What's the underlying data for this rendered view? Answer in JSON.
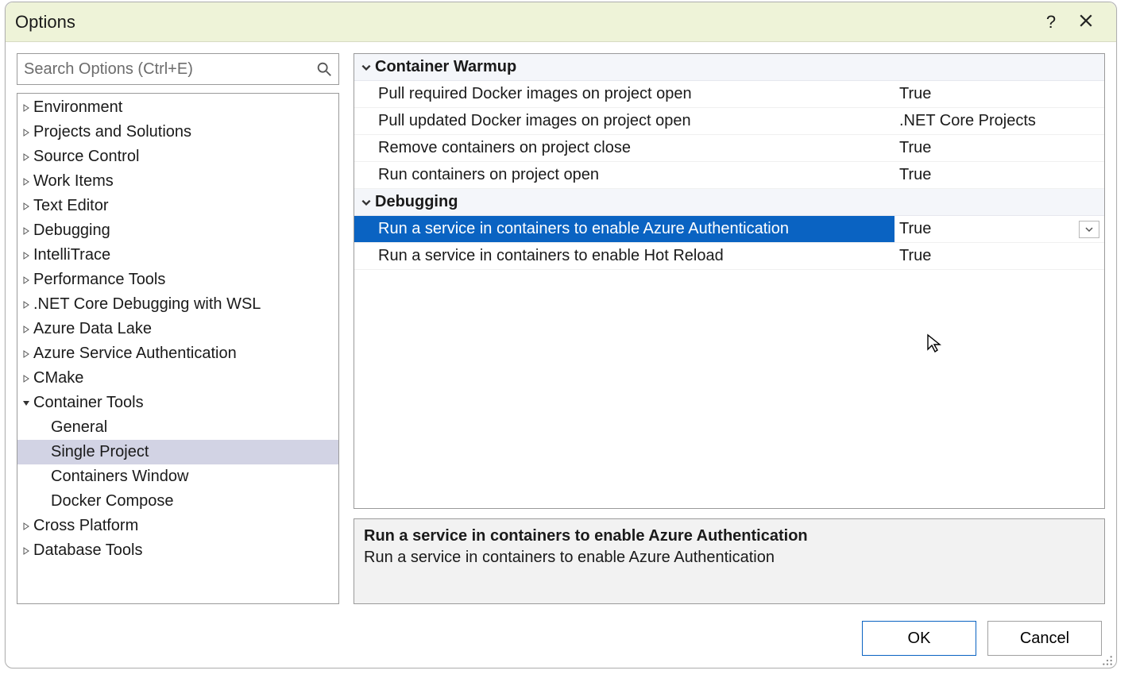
{
  "window": {
    "title": "Options",
    "help_tooltip": "?",
    "close_tooltip": "Close"
  },
  "search": {
    "placeholder": "Search Options (Ctrl+E)",
    "value": ""
  },
  "tree": [
    {
      "label": "Environment",
      "expanded": false,
      "depth": 0
    },
    {
      "label": "Projects and Solutions",
      "expanded": false,
      "depth": 0
    },
    {
      "label": "Source Control",
      "expanded": false,
      "depth": 0
    },
    {
      "label": "Work Items",
      "expanded": false,
      "depth": 0
    },
    {
      "label": "Text Editor",
      "expanded": false,
      "depth": 0
    },
    {
      "label": "Debugging",
      "expanded": false,
      "depth": 0
    },
    {
      "label": "IntelliTrace",
      "expanded": false,
      "depth": 0
    },
    {
      "label": "Performance Tools",
      "expanded": false,
      "depth": 0
    },
    {
      "label": ".NET Core Debugging with WSL",
      "expanded": false,
      "depth": 0
    },
    {
      "label": "Azure Data Lake",
      "expanded": false,
      "depth": 0
    },
    {
      "label": "Azure Service Authentication",
      "expanded": false,
      "depth": 0
    },
    {
      "label": "CMake",
      "expanded": false,
      "depth": 0
    },
    {
      "label": "Container Tools",
      "expanded": true,
      "depth": 0
    },
    {
      "label": "General",
      "expanded": null,
      "depth": 1
    },
    {
      "label": "Single Project",
      "expanded": null,
      "depth": 1,
      "selected": true
    },
    {
      "label": "Containers Window",
      "expanded": null,
      "depth": 1
    },
    {
      "label": "Docker Compose",
      "expanded": null,
      "depth": 1
    },
    {
      "label": "Cross Platform",
      "expanded": false,
      "depth": 0
    },
    {
      "label": "Database Tools",
      "expanded": false,
      "depth": 0
    }
  ],
  "properties": {
    "groups": [
      {
        "title": "Container Warmup",
        "rows": [
          {
            "label": "Pull required Docker images on project open",
            "value": "True"
          },
          {
            "label": "Pull updated Docker images on project open",
            "value": ".NET Core Projects"
          },
          {
            "label": "Remove containers on project close",
            "value": "True"
          },
          {
            "label": "Run containers on project open",
            "value": "True"
          }
        ]
      },
      {
        "title": "Debugging",
        "rows": [
          {
            "label": "Run a service in containers to enable Azure Authentication",
            "value": "True",
            "selected": true,
            "dropdown": true
          },
          {
            "label": "Run a service in containers to enable Hot Reload",
            "value": "True"
          }
        ]
      }
    ]
  },
  "description": {
    "title": "Run a service in containers to enable Azure Authentication",
    "text": "Run a service in containers to enable Azure Authentication"
  },
  "buttons": {
    "ok": "OK",
    "cancel": "Cancel"
  }
}
